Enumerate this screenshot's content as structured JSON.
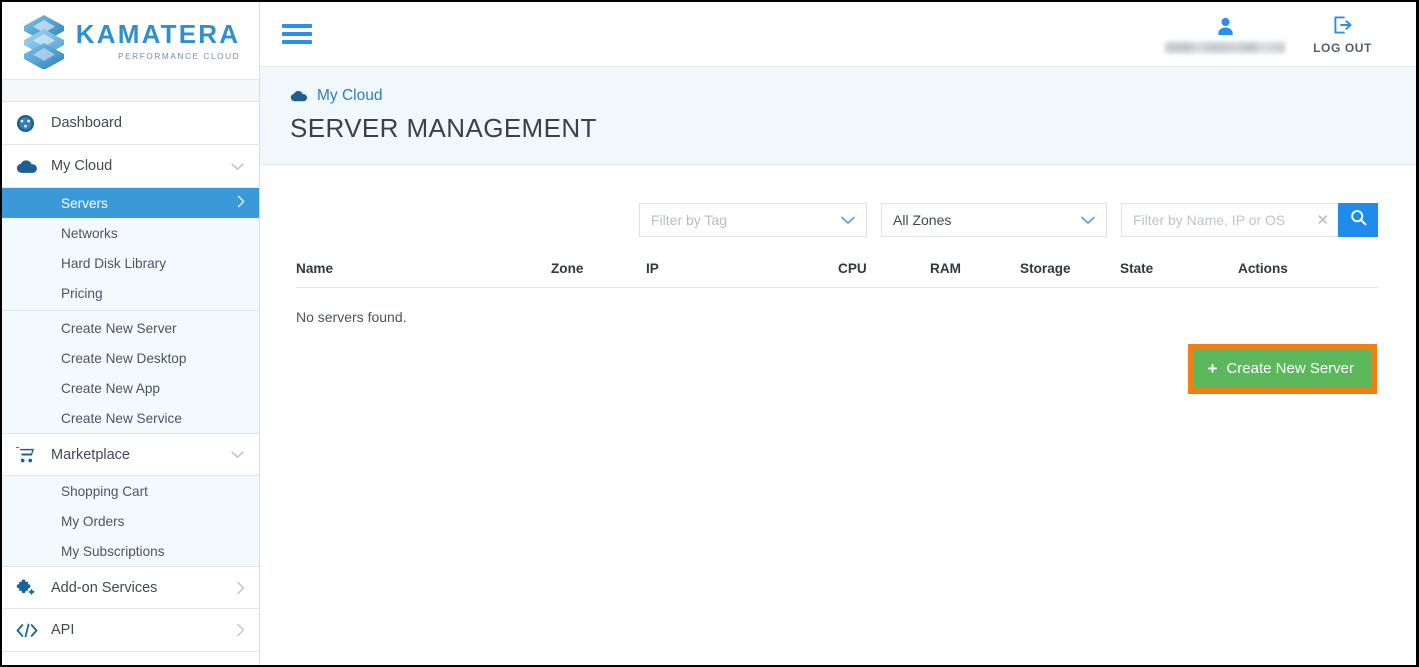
{
  "brand": {
    "name": "KAMATERA",
    "tagline": "PERFORMANCE CLOUD",
    "logo_icon": "stacked-layers-logo",
    "accent_blue": "#2f8fd0"
  },
  "sidebar": {
    "items": [
      {
        "label": "Dashboard",
        "icon": "dashboard-gauge-icon",
        "chevron": ""
      },
      {
        "label": "My Cloud",
        "icon": "cloud-icon",
        "chevron": "chevron-down-icon"
      },
      {
        "label": "Marketplace",
        "icon": "shopping-cart-icon",
        "chevron": "chevron-down-icon"
      },
      {
        "label": "Add-on Services",
        "icon": "puzzle-piece-icon",
        "chevron": "chevron-right-icon"
      },
      {
        "label": "API",
        "icon": "code-brackets-icon",
        "chevron": "chevron-right-icon"
      }
    ],
    "my_cloud_sub": [
      {
        "label": "Servers",
        "active": true,
        "arrow": "chevron-right-icon"
      },
      {
        "label": "Networks",
        "active": false,
        "arrow": ""
      },
      {
        "label": "Hard Disk Library",
        "active": false,
        "arrow": ""
      },
      {
        "label": "Pricing",
        "active": false,
        "arrow": ""
      }
    ],
    "my_cloud_sub2": [
      {
        "label": "Create New Server"
      },
      {
        "label": "Create New Desktop"
      },
      {
        "label": "Create New App"
      },
      {
        "label": "Create New Service"
      }
    ],
    "marketplace_sub": [
      {
        "label": "Shopping Cart"
      },
      {
        "label": "My Orders"
      },
      {
        "label": "My Subscriptions"
      }
    ],
    "active_color": "#3a9ad9",
    "submenu_bg": "#f3fafd"
  },
  "topbar": {
    "menu_icon": "hamburger-menu-icon",
    "user_icon": "user-avatar-icon",
    "username": "",
    "logout_icon": "logout-arrow-icon",
    "logout_label": "LOG OUT"
  },
  "pagehead": {
    "breadcrumb_icon": "cloud-icon",
    "breadcrumb": "My Cloud",
    "title": "SERVER MANAGEMENT"
  },
  "filters": {
    "tag": {
      "placeholder": "Filter by Tag",
      "value": "",
      "dropdown_icon": "chevron-down-icon"
    },
    "zone": {
      "value": "All Zones",
      "dropdown_icon": "chevron-down-icon"
    },
    "search": {
      "placeholder": "Filter by Name, IP or OS",
      "value": "",
      "clear_icon": "close-x-icon",
      "search_icon": "search-magnifier-icon",
      "button_color": "#1f8ceb"
    }
  },
  "table": {
    "columns": [
      "Name",
      "Zone",
      "IP",
      "CPU",
      "RAM",
      "Storage",
      "State",
      "Actions"
    ],
    "rows": [],
    "empty_message": "No servers found."
  },
  "cta": {
    "label": "Create New Server",
    "plus_icon": "plus-icon",
    "bg_color": "#5cb85c",
    "highlight_color": "#f07f15"
  }
}
